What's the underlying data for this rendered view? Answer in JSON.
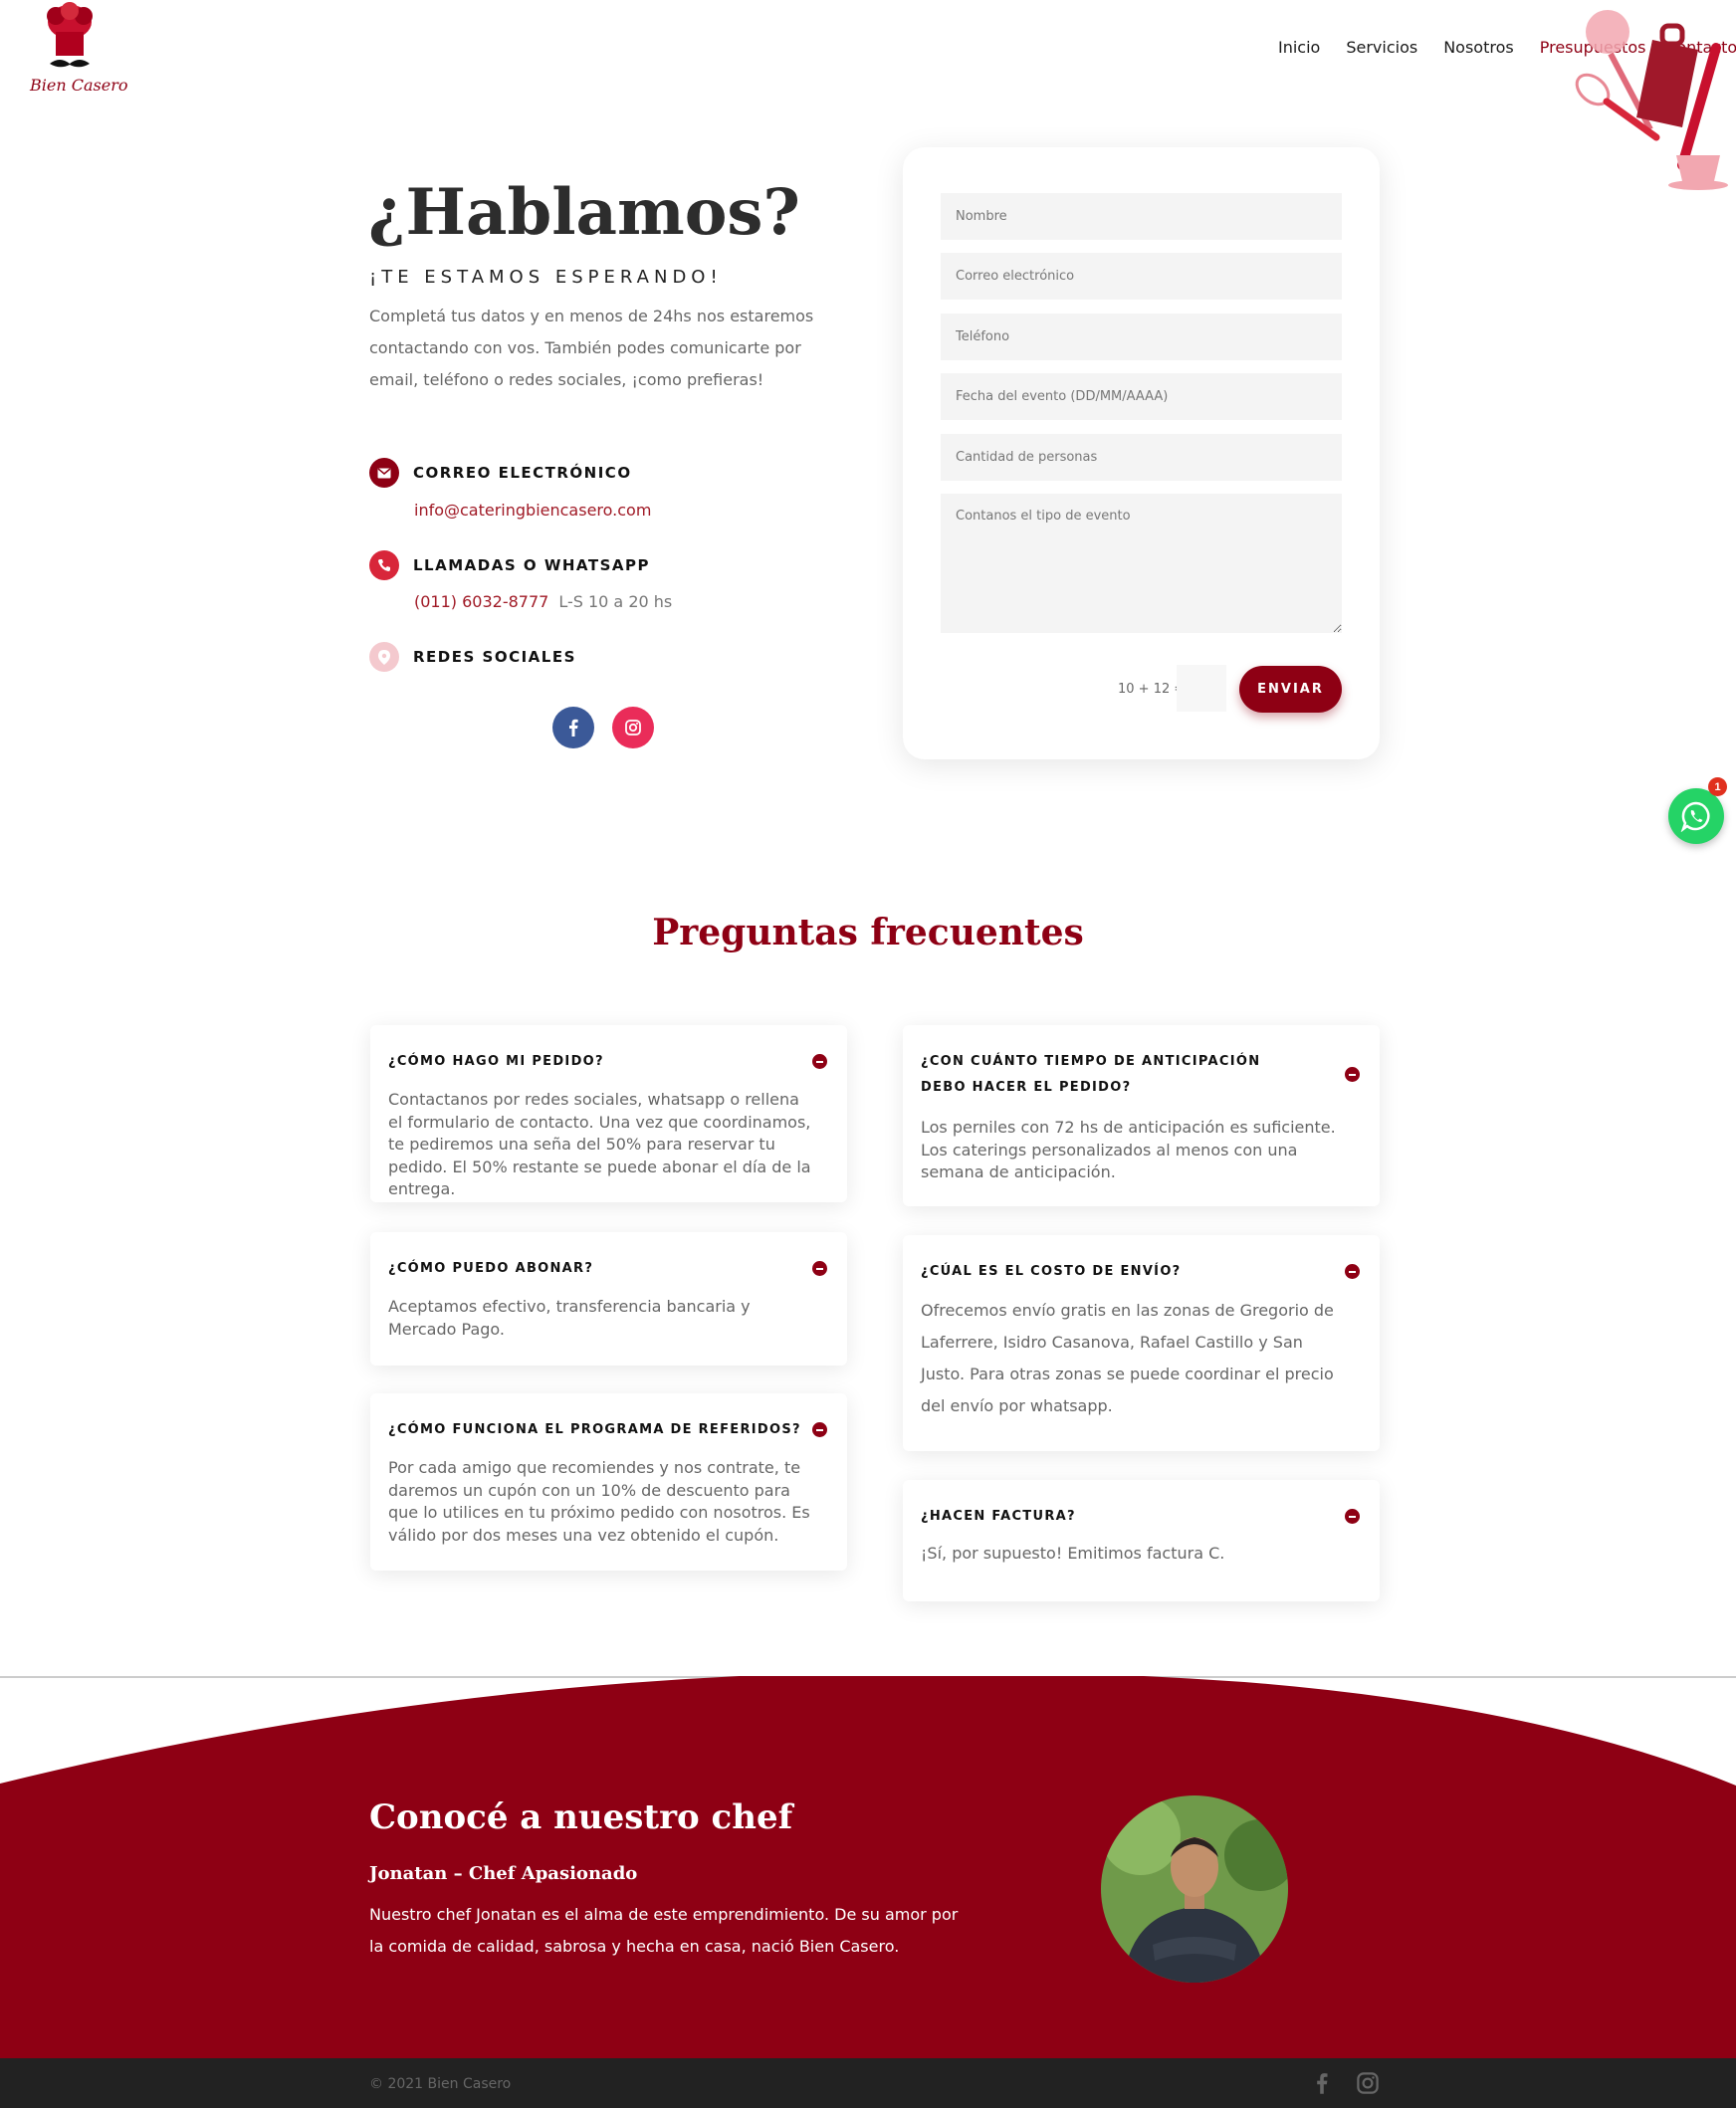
{
  "brand": {
    "logo_text": "Bien Casero",
    "accent_color": "#8e0014"
  },
  "nav": {
    "items": [
      "Inicio",
      "Servicios",
      "Nosotros",
      "Presupuestos y Contacto"
    ]
  },
  "hero": {
    "title": "¿Hablamos?",
    "subtitle": "¡TE ESTAMOS ESPERANDO!",
    "description": "Completá tus datos y en menos de 24hs nos estaremos contactando con vos. También podes comunicarte por email, teléfono o redes sociales, ¡como prefieras!"
  },
  "contact": {
    "email_label": "CORREO ELECTRÓNICO",
    "email_value": "info@cateringbiencasero.com",
    "phone_label": "LLAMADAS O WHATSAPP",
    "phone_value": "(011) 6032-8777",
    "phone_hours": "L-S 10 a 20 hs",
    "social_label": "REDES SOCIALES",
    "social_icons": [
      "facebook-icon",
      "instagram-icon"
    ]
  },
  "form": {
    "name_placeholder": "Nombre",
    "email_placeholder": "Correo electrónico",
    "phone_placeholder": "Teléfono",
    "date_placeholder": "Fecha del evento (DD/MM/AAAA)",
    "people_placeholder": "Cantidad de personas",
    "message_placeholder": "Contanos el tipo de evento",
    "captcha_label": "10 + 12 =",
    "submit_label": "ENVIAR"
  },
  "whatsapp": {
    "badge": "1"
  },
  "faq": {
    "title": "Preguntas frecuentes",
    "items": [
      {
        "question": "¿CÓMO HAGO MI PEDIDO?",
        "answer": "Contactanos por redes sociales, whatsapp o rellena el formulario de contacto. Una vez que coordinamos, te pediremos una seña del 50% para reservar tu pedido. El 50% restante se puede abonar el día de la entrega."
      },
      {
        "question": "¿CÓMO PUEDO ABONAR?",
        "answer": "Aceptamos efectivo, transferencia bancaria y Mercado Pago."
      },
      {
        "question": "¿CÓMO FUNCIONA EL PROGRAMA DE REFERIDOS?",
        "answer": "Por cada amigo que recomiendes y nos contrate, te daremos un cupón con un 10% de descuento para que lo utilices en tu próximo pedido con nosotros. Es válido por dos meses una vez obtenido el cupón."
      },
      {
        "question": "¿CON CUÁNTO TIEMPO DE ANTICIPACIÓN DEBO HACER EL PEDIDO?",
        "answer": "Los perniles con 72 hs de anticipación es suficiente. Los caterings personalizados al menos con una semana de anticipación."
      },
      {
        "question": "¿CÚAL ES EL COSTO DE ENVÍO?",
        "answer": "Ofrecemos envío gratis en las zonas de Gregorio de Laferrere, Isidro Casanova, Rafael Castillo y San Justo. Para otras zonas se puede coordinar el precio del envío por whatsapp."
      },
      {
        "question": "¿HACEN FACTURA?",
        "answer": "¡Sí, por supuesto! Emitimos factura C."
      }
    ]
  },
  "chef": {
    "title": "Conocé a nuestro chef",
    "subtitle": "Jonatan – Chef Apasionado",
    "description": "Nuestro chef Jonatan es el alma de este emprendimiento. De su amor por la comida de calidad, sabrosa y hecha en casa, nació Bien Casero."
  },
  "footer": {
    "copyright": "© 2021 Bien Casero"
  }
}
